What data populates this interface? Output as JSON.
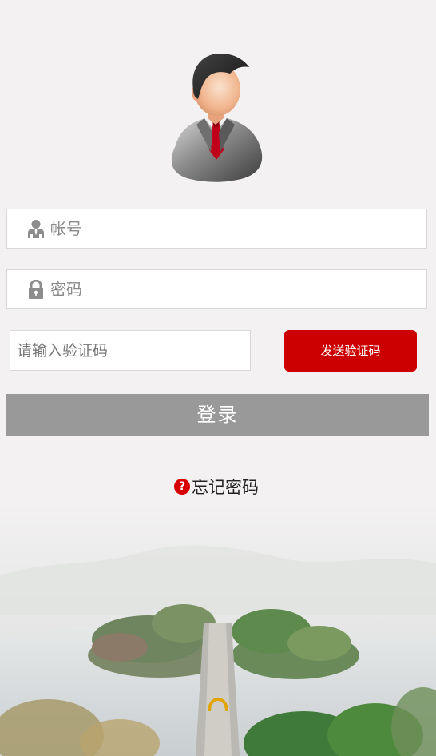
{
  "login_form": {
    "account_placeholder": "帐号",
    "password_placeholder": "密码",
    "code_placeholder": "请输入验证码",
    "send_code_label": "发送验证码",
    "login_label": "登录",
    "forgot_icon_text": "?",
    "forgot_label": "忘记密码"
  },
  "icons": {
    "avatar": "businessman-avatar-icon",
    "account": "user-icon",
    "password": "lock-icon",
    "help": "question-circle-icon"
  },
  "colors": {
    "background": "#f3f1f1",
    "send_button": "#cc0000",
    "login_button": "#999999",
    "help_icon": "#d60000"
  }
}
